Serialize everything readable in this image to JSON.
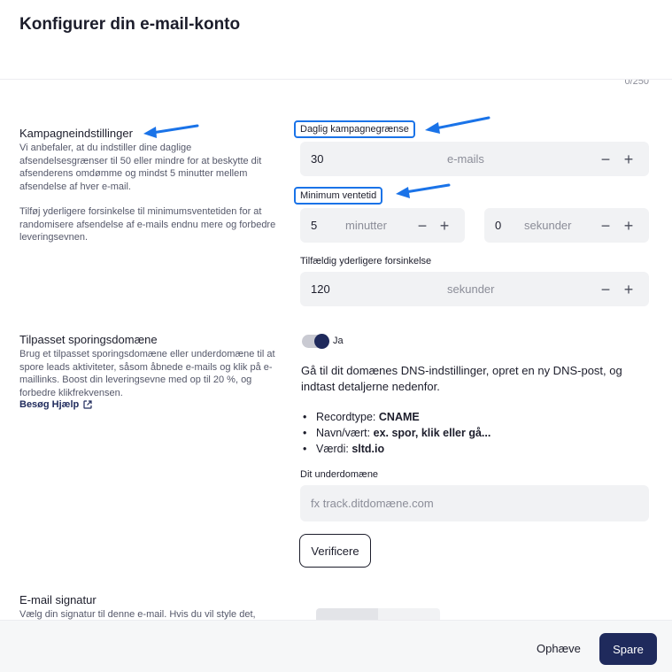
{
  "header": {
    "title": "Konfigurer din e-mail-konto"
  },
  "counter": "0/250",
  "campaign": {
    "title": "Kampagneindstillinger",
    "desc1": "Vi anbefaler, at du indstiller dine daglige afsendelsesgrænser til 50 eller mindre for at beskytte dit afsenderens omdømme og mindst 5 minutter mellem afsendelse af hver e-mail.",
    "desc2": "Tilføj yderligere forsinkelse til minimumsventetiden for at randomisere afsendelse af e-mails endnu mere og forbedre leveringsevnen.",
    "daily_limit": {
      "label": "Daglig kampagnegrænse",
      "value": "30",
      "unit": "e-mails"
    },
    "min_wait": {
      "label": "Minimum ventetid",
      "minutes": {
        "value": "5",
        "unit": "minutter"
      },
      "seconds": {
        "value": "0",
        "unit": "sekunder"
      }
    },
    "random_delay": {
      "label": "Tilfældig yderligere forsinkelse",
      "value": "120",
      "unit": "sekunder"
    }
  },
  "tracking": {
    "title": "Tilpasset sporingsdomæne",
    "desc": "Brug et tilpasset sporingsdomæne eller underdomæne til at spore leads aktiviteter, såsom åbnede e-mails og klik på e-maillinks. Boost din leveringsevne med op til 20 %, og forbedre klikfrekvensen.",
    "help_link": "Besøg Hjælp",
    "toggle_label": "Ja",
    "toggle_on": true,
    "instructions": "Gå til dit domænes DNS-indstillinger, opret en ny DNS-post, og indtast detaljerne nedenfor.",
    "records": [
      {
        "key": "Recordtype:",
        "value": "CNAME"
      },
      {
        "key": "Navn/vært:",
        "value": "ex. spor, klik eller gå..."
      },
      {
        "key": "Værdi:",
        "value": "sltd.io"
      }
    ],
    "subdomain_label": "Dit underdomæne",
    "subdomain_placeholder": "fx track.ditdomæne.com",
    "verify_label": "Verificere"
  },
  "signature": {
    "title": "E-mail signatur",
    "desc": "Vælg din signatur til denne e-mail. Hvis du vil style det,"
  },
  "footer": {
    "cancel_label": "Ophæve",
    "save_label": "Spare"
  },
  "colors": {
    "primary": "#1f2a5c",
    "annotation": "#1a73e8",
    "field_bg": "#f1f2f4"
  },
  "controls": {
    "minus": "−",
    "plus": "+"
  }
}
